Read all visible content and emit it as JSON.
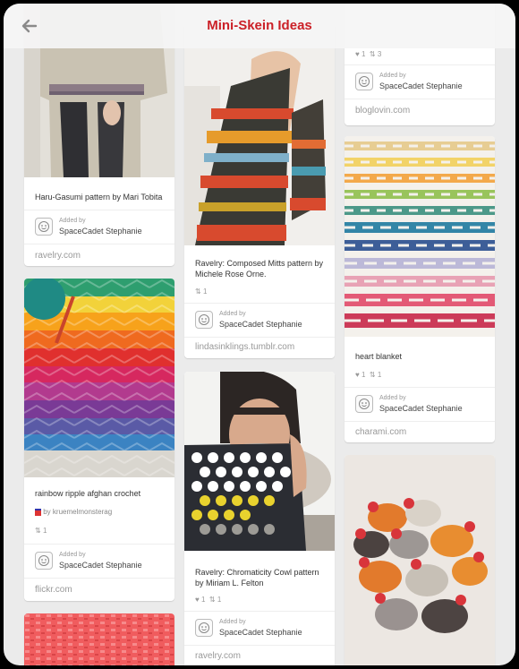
{
  "header": {
    "title": "Mini-Skein Ideas",
    "back_icon": "arrow-left-icon",
    "accent": "#cb2027"
  },
  "pins": {
    "haru": {
      "description": "Haru-Gasumi pattern by Mari Tobita",
      "added_label": "Added by",
      "pinner": "SpaceCadet Stephanie",
      "source": "ravelry.com"
    },
    "rainbow": {
      "description": "rainbow ripple afghan crochet",
      "attribution": "by kruemelmonsterag",
      "repins": "1",
      "added_label": "Added by",
      "pinner": "SpaceCadet Stephanie",
      "source": "flickr.com"
    },
    "mitts": {
      "description": "Ravelry: Composed Mitts pattern by Michele Rose Orne.",
      "repins": "1",
      "added_label": "Added by",
      "pinner": "SpaceCadet Stephanie",
      "source": "lindasinklings.tumblr.com"
    },
    "cowl": {
      "description": "Ravelry: Chromaticity Cowl pattern by Miriam L. Felton",
      "likes": "1",
      "repins": "1",
      "added_label": "Added by",
      "pinner": "SpaceCadet Stephanie",
      "source": "ravelry.com"
    },
    "bloglovin": {
      "likes": "1",
      "repins": "3",
      "added_label": "Added by",
      "pinner": "SpaceCadet Stephanie",
      "source": "bloglovin.com"
    },
    "heart": {
      "description": "heart blanket",
      "likes": "1",
      "repins": "1",
      "added_label": "Added by",
      "pinner": "SpaceCadet Stephanie",
      "source": "charami.com"
    }
  }
}
